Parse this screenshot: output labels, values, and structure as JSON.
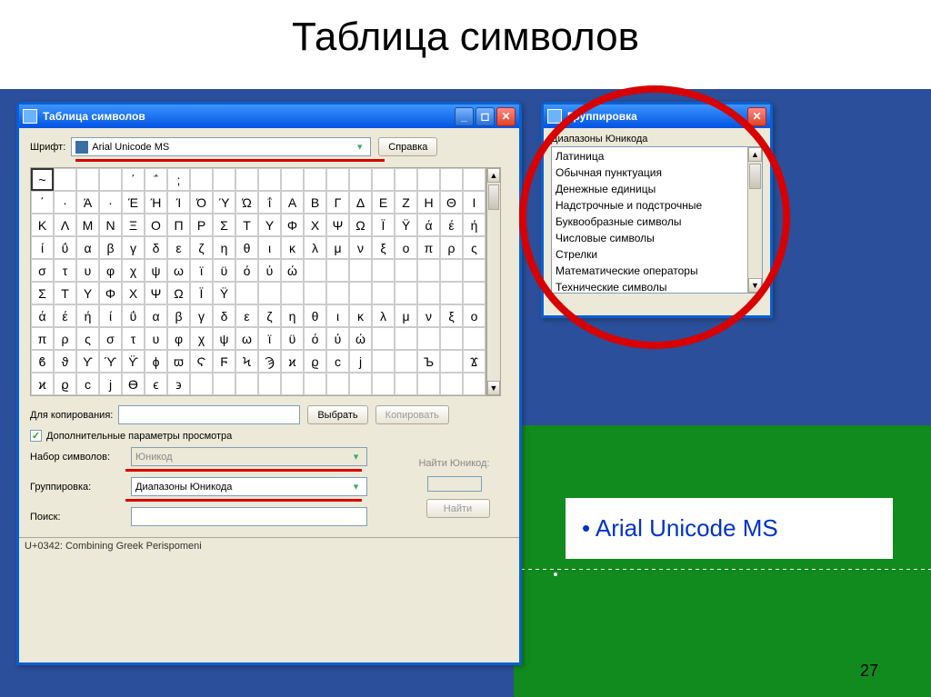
{
  "slide": {
    "title": "Таблица символов",
    "number": "27",
    "bullet_note": "Arial Unicode MS"
  },
  "charmap_window": {
    "title": "Таблица символов",
    "font_label": "Шрифт:",
    "font_value": "Arial Unicode MS",
    "help_btn": "Справка",
    "copy_label": "Для копирования:",
    "select_btn": "Выбрать",
    "copy_btn": "Копировать",
    "advanced_checkbox": "Дополнительные параметры просмотра",
    "charset_label": "Набор символов:",
    "charset_value": "Юникод",
    "grouping_label": "Группировка:",
    "grouping_value": "Диапазоны Юникода",
    "search_label": "Поиск:",
    "find_unicode_label": "Найти Юникод:",
    "find_btn": "Найти",
    "status": "U+0342: Combining Greek Perispomeni",
    "grid_rows": [
      [
        "~",
        " ",
        " ",
        " ",
        "΄",
        "΅",
        ";",
        " ",
        " ",
        " ",
        " ",
        " ",
        " ",
        " ",
        " ",
        " ",
        " ",
        " ",
        " ",
        " "
      ],
      [
        "΄",
        "·",
        "Ά",
        "·",
        "Έ",
        "Ή",
        "Ί",
        "Ό",
        "Ύ",
        "Ώ",
        "ΐ",
        "Α",
        "Β",
        "Γ",
        "Δ",
        "Ε",
        "Ζ",
        "Η",
        "Θ",
        "Ι"
      ],
      [
        "Κ",
        "Λ",
        "Μ",
        "Ν",
        "Ξ",
        "Ο",
        "Π",
        "Ρ",
        "Σ",
        "Τ",
        "Υ",
        "Φ",
        "Χ",
        "Ψ",
        "Ω",
        "Ϊ",
        "Ϋ",
        "ά",
        "έ",
        "ή"
      ],
      [
        "ί",
        "ΰ",
        "α",
        "β",
        "γ",
        "δ",
        "ε",
        "ζ",
        "η",
        "θ",
        "ι",
        "κ",
        "λ",
        "μ",
        "ν",
        "ξ",
        "ο",
        "π",
        "ρ",
        "ς"
      ],
      [
        "σ",
        "τ",
        "υ",
        "φ",
        "χ",
        "ψ",
        "ω",
        "ϊ",
        "ϋ",
        "ό",
        "ύ",
        "ώ",
        " ",
        " ",
        " ",
        " ",
        " ",
        " ",
        " ",
        " "
      ],
      [
        "Σ",
        "Τ",
        "Υ",
        "Φ",
        "Χ",
        "Ψ",
        "Ω",
        "Ϊ",
        "Ϋ",
        " ",
        " ",
        " ",
        " ",
        " ",
        " ",
        " ",
        " ",
        " ",
        " ",
        " "
      ],
      [
        "ά",
        "έ",
        "ή",
        "ί",
        "ΰ",
        "α",
        "β",
        "γ",
        "δ",
        "ε",
        "ζ",
        "η",
        "θ",
        "ι",
        "κ",
        "λ",
        "μ",
        "ν",
        "ξ",
        "ο"
      ],
      [
        "π",
        "ρ",
        "ς",
        "σ",
        "τ",
        "υ",
        "φ",
        "χ",
        "ψ",
        "ω",
        "ϊ",
        "ϋ",
        "ό",
        "ύ",
        "ώ",
        " ",
        " ",
        " ",
        " ",
        " "
      ],
      [
        "ϐ",
        "ϑ",
        "ϒ",
        "ϓ",
        "ϔ",
        "ϕ",
        "ϖ",
        "Ϛ",
        "Ϝ",
        "Ϟ",
        "Ϡ",
        "ϰ",
        "ϱ",
        "ϲ",
        "ϳ",
        " ",
        " ",
        "Ъ",
        " ",
        "Ϫ"
      ],
      [
        "ϰ",
        "ϱ",
        "ϲ",
        "ϳ",
        "ϴ",
        "ϵ",
        "϶",
        " ",
        " ",
        " ",
        " ",
        " ",
        " ",
        " ",
        " ",
        " ",
        " ",
        " ",
        " ",
        " "
      ]
    ]
  },
  "grouping_window": {
    "title": "Группировка",
    "heading": "Диапазоны Юникода",
    "items": [
      "Латиница",
      "Обычная пунктуация",
      "Денежные единицы",
      "Надстрочные и подстрочные",
      "Буквообразные символы",
      "Числовые символы",
      "Стрелки",
      "Математические операторы",
      "Технические символы"
    ]
  }
}
